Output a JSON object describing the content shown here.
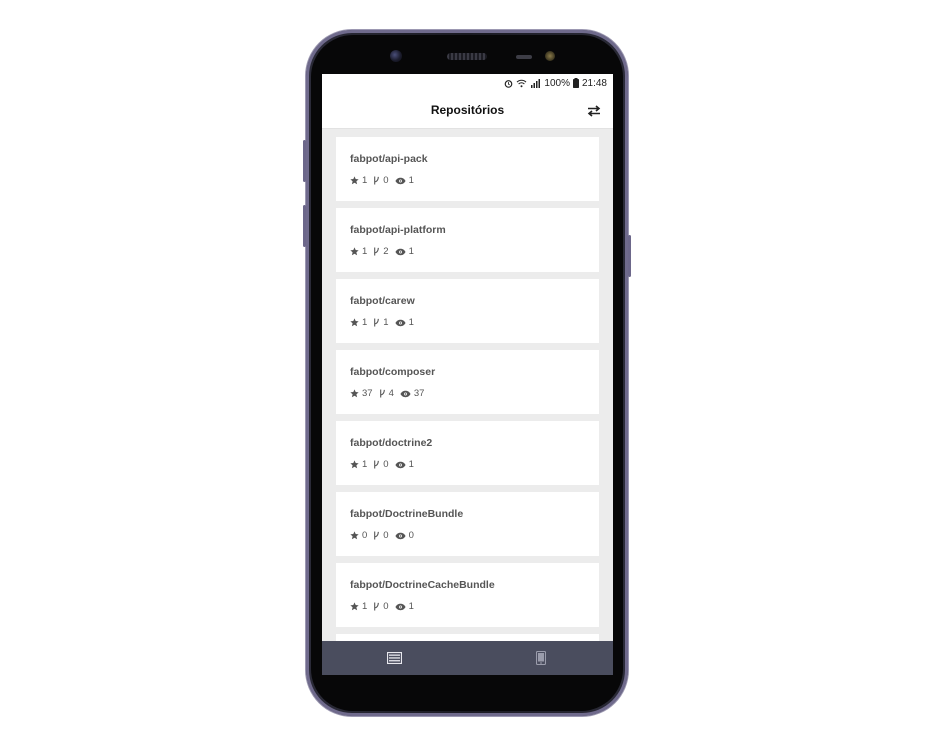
{
  "status_bar": {
    "battery": "100%",
    "time": "21:48",
    "icons": [
      "alarm-icon",
      "wifi-icon",
      "signal-icon",
      "battery-icon"
    ]
  },
  "app_bar": {
    "title": "Repositórios",
    "action_icon": "swap-icon"
  },
  "repositories": [
    {
      "name": "fabpot/api-pack",
      "stars": "1",
      "forks": "0",
      "watchers": "1"
    },
    {
      "name": "fabpot/api-platform",
      "stars": "1",
      "forks": "2",
      "watchers": "1"
    },
    {
      "name": "fabpot/carew",
      "stars": "1",
      "forks": "1",
      "watchers": "1"
    },
    {
      "name": "fabpot/composer",
      "stars": "37",
      "forks": "4",
      "watchers": "37"
    },
    {
      "name": "fabpot/doctrine2",
      "stars": "1",
      "forks": "0",
      "watchers": "1"
    },
    {
      "name": "fabpot/DoctrineBundle",
      "stars": "0",
      "forks": "0",
      "watchers": "0"
    },
    {
      "name": "fabpot/DoctrineCacheBundle",
      "stars": "1",
      "forks": "0",
      "watchers": "1"
    }
  ],
  "bottom_nav": {
    "items": [
      {
        "icon": "list-icon"
      },
      {
        "icon": "tablet-icon"
      }
    ]
  },
  "colors": {
    "screen_background": "#ececec",
    "card_background": "#ffffff",
    "bottom_nav": "#4a4d5e",
    "text": "#555555"
  }
}
